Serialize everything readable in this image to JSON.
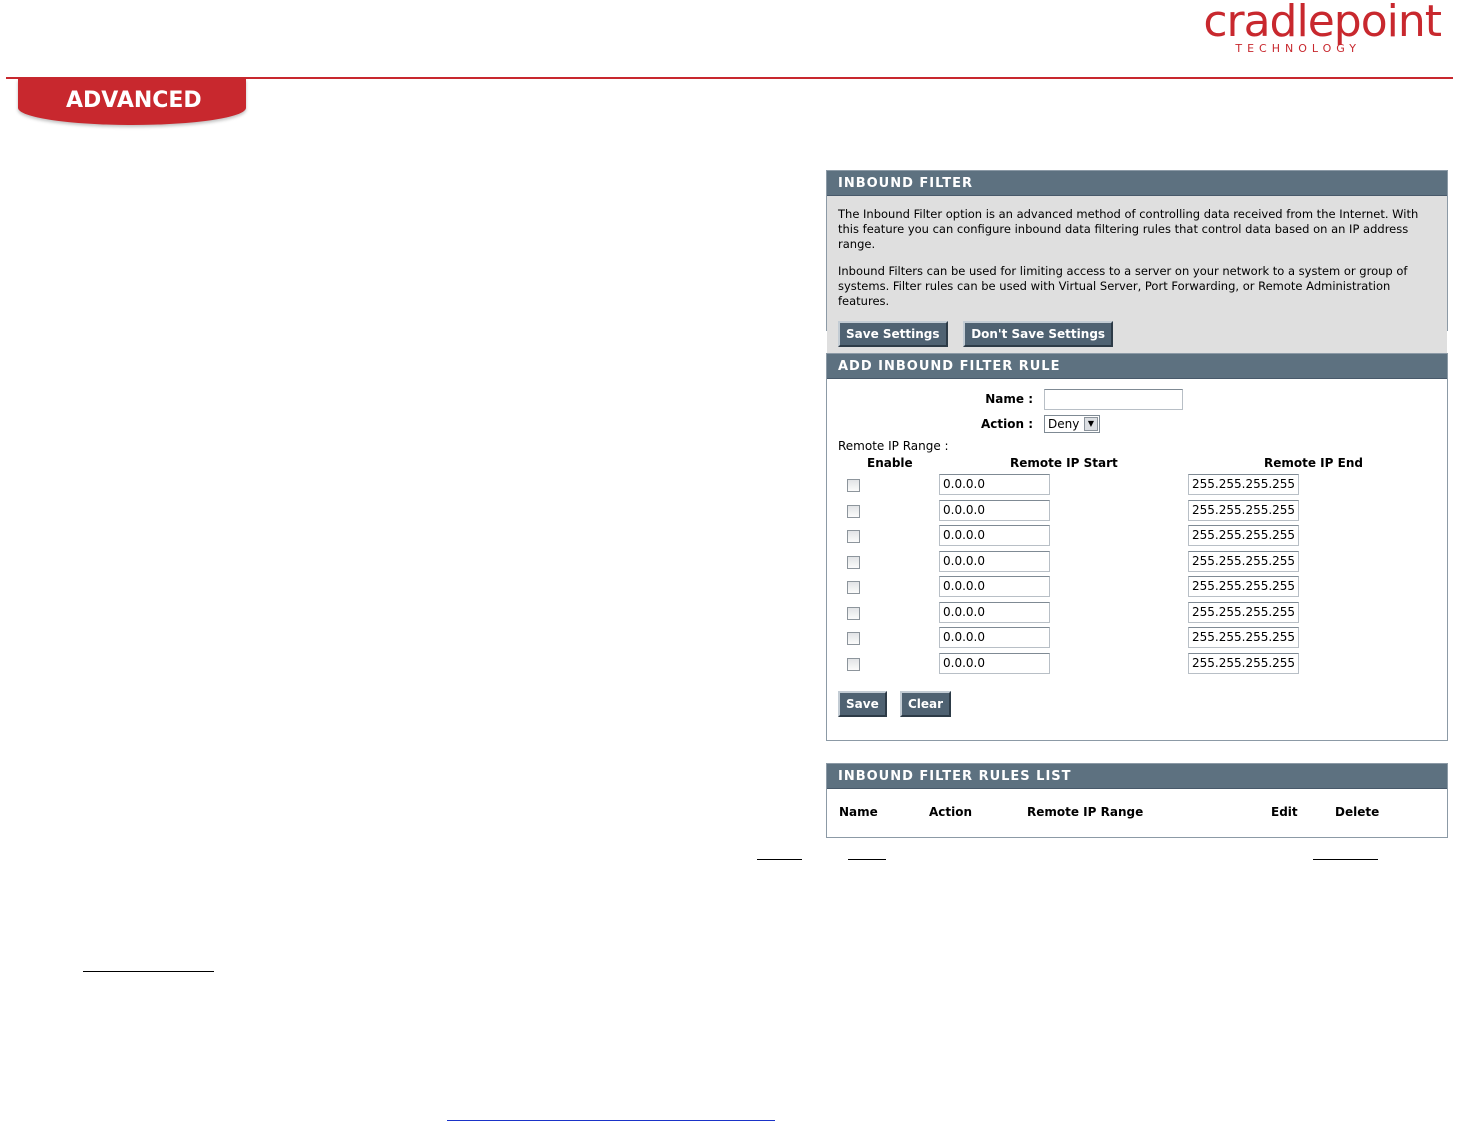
{
  "brand": {
    "logo_text": "cradlepoint",
    "logo_sub": "TECHNOLOGY",
    "section_tab": "ADVANCED",
    "accent_color": "#c8282e"
  },
  "inbound_filter": {
    "title": "INBOUND FILTER",
    "para1": "The Inbound Filter option is an advanced method of controlling data received from the Internet. With this feature you can configure inbound data filtering rules that control data based on an IP address range.",
    "para2": "Inbound Filters can be used for limiting access to a server on your network to a system or group of systems. Filter rules can be used with Virtual Server, Port Forwarding, or Remote Administration features.",
    "save_label": "Save Settings",
    "dont_save_label": "Don't Save Settings"
  },
  "add_rule": {
    "title": "ADD INBOUND FILTER RULE",
    "name_label": "Name :",
    "name_value": "",
    "action_label": "Action :",
    "action_value": "Deny",
    "range_label": "Remote IP Range :",
    "col_enable": "Enable",
    "col_start": "Remote IP Start",
    "col_end": "Remote IP End",
    "rows": [
      {
        "start": "0.0.0.0",
        "end": "255.255.255.255"
      },
      {
        "start": "0.0.0.0",
        "end": "255.255.255.255"
      },
      {
        "start": "0.0.0.0",
        "end": "255.255.255.255"
      },
      {
        "start": "0.0.0.0",
        "end": "255.255.255.255"
      },
      {
        "start": "0.0.0.0",
        "end": "255.255.255.255"
      },
      {
        "start": "0.0.0.0",
        "end": "255.255.255.255"
      },
      {
        "start": "0.0.0.0",
        "end": "255.255.255.255"
      },
      {
        "start": "0.0.0.0",
        "end": "255.255.255.255"
      }
    ],
    "save_label": "Save",
    "clear_label": "Clear"
  },
  "rules_list": {
    "title": "INBOUND FILTER RULES LIST",
    "headers": {
      "name": "Name",
      "action": "Action",
      "range": "Remote IP Range",
      "edit": "Edit",
      "delete": "Delete"
    }
  }
}
